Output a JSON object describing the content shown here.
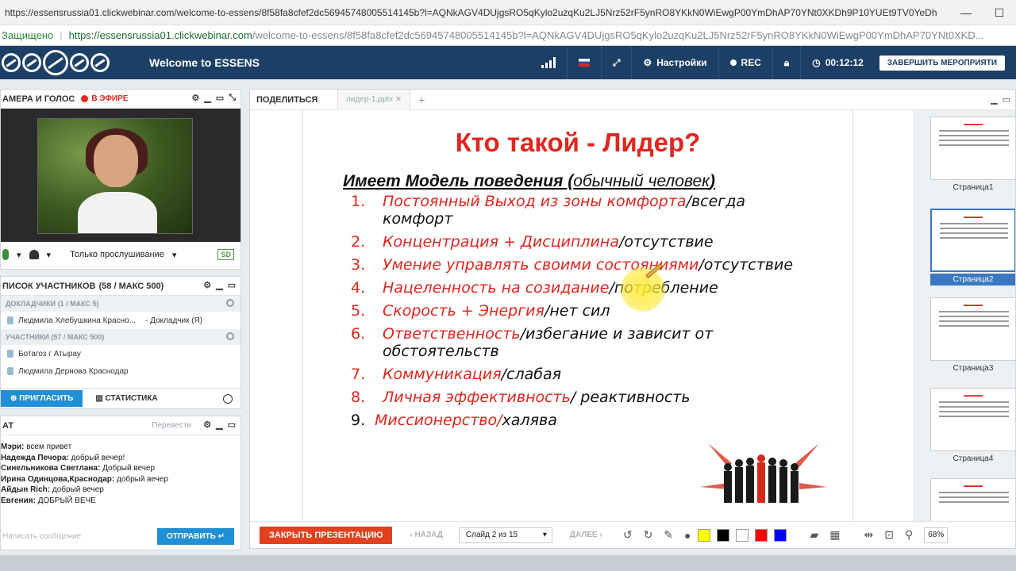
{
  "browser": {
    "tab_url": "https://essensrussia01.clickwebinar.com/welcome-to-essens/8f58fa8cfef2dc56945748005514145b?l=AQNkAGV4DUjgsRO5qKylo2uzqKu2LJ5Nrz52rF5ynRO8YKkN0WiEwgP00YmDhAP70YNt0XKDh9P10YUEt9TV0YeDhAP90Y...",
    "secure_label": "Защищено",
    "url_host": "https://essensrussia01.clickwebinar.com",
    "url_path": "/welcome-to-essens/8f58fa8cfef2dc56945748005514145b?l=AQNkAGV4DUjgsRO5qKylo2uzqKu2LJ5Nrz52rF5ynRO8YKkN0WiEwgP00YmDhAP70YNt0XKD..."
  },
  "header": {
    "title": "Welcome to ESSENS",
    "settings": "Настройки",
    "rec": "REC",
    "timer": "00:12:12",
    "end_button": "ЗАВЕРШИТЬ МЕРОПРИЯТИ"
  },
  "camera": {
    "title": "АМЕРА И ГОЛОС",
    "live": "В ЭФИРЕ",
    "listen_mode": "Только прослушивание",
    "sd": "SD"
  },
  "participants": {
    "title": "ПИСОК УЧАСТНИКОВ",
    "count": "(58 / МАКС 500)",
    "speakers_head": "ДОКЛАДЧИКИ (1 / МАКС 5)",
    "speaker": "Людмила Хлебушкина Красно...",
    "speaker_role": "- Докладчик (Я)",
    "members_head": "УЧАСТНИКИ (57 / МАКС 500)",
    "members": [
      "Ботагоз г Атырау",
      "Людмила Дернова Краснодар"
    ],
    "invite": "ПРИГЛАСИТЬ",
    "stats": "СТАТИСТИКА"
  },
  "chat": {
    "title": "АТ",
    "translate": "Перевести",
    "messages": [
      {
        "author": "Мэри:",
        "text": "всем привет"
      },
      {
        "author": "Надежда Печора:",
        "text": "добрый вечер!"
      },
      {
        "author": "Синельникова Светлана:",
        "text": "Добрый вечер"
      },
      {
        "author": "Ирина Одинцова,Краснодар:",
        "text": "добрый вечер"
      },
      {
        "author": "Айдын Rich:",
        "text": "добрый вечер"
      },
      {
        "author": "Евгения:",
        "text": "ДОБРЫЙ ВЕЧЕ"
      }
    ],
    "placeholder": "Написать сообщение",
    "send": "ОТПРАВИТЬ"
  },
  "presentation": {
    "share_label": "ПОДЕЛИТЬСЯ",
    "tab_name": "лидер-1.pptx",
    "slide": {
      "title": "Кто такой - Лидер?",
      "subtitle_bold": "Имеет Модель поведения (",
      "subtitle_normal": "обычный человек",
      "subtitle_end": ")",
      "items": [
        {
          "num": "1.",
          "red": "Постоянный Выход из зоны комфорта",
          "black": "/всегда комфорт"
        },
        {
          "num": "2.",
          "red": "Концентрация + Дисциплина",
          "black": "/отсутствие"
        },
        {
          "num": "3.",
          "red": "Умение управлять своими состояниями",
          "black": "/отсутствие"
        },
        {
          "num": "4.",
          "red": "Нацеленность на созидание",
          "black": "/потребление"
        },
        {
          "num": "5.",
          "red": "Скорость + Энергия",
          "black": "/нет сил"
        },
        {
          "num": "6.",
          "red": "Ответственность",
          "black": "/избегание и зависит от обстоятельств"
        },
        {
          "num": "7.",
          "red": "Коммуникация",
          "black": "/слабая"
        },
        {
          "num": "8.",
          "red": "Личная эффективность",
          "black": "/ реактивность"
        },
        {
          "num": "9.",
          "red": "Миссионерство/",
          "black": "халява"
        }
      ]
    },
    "toolbar": {
      "close": "ЗАКРЫТЬ ПРЕЗЕНТАЦИЮ",
      "back": "НАЗАД",
      "slide_of": "Слайд 2 из 15",
      "next": "ДАЛЕЕ",
      "zoom": "68%",
      "colors": [
        "#ffff00",
        "#000000",
        "#ffffff",
        "#ff0000",
        "#0000ff"
      ]
    },
    "thumbnails": [
      "Страница1",
      "Страница2",
      "Страница3",
      "Страница4"
    ]
  }
}
